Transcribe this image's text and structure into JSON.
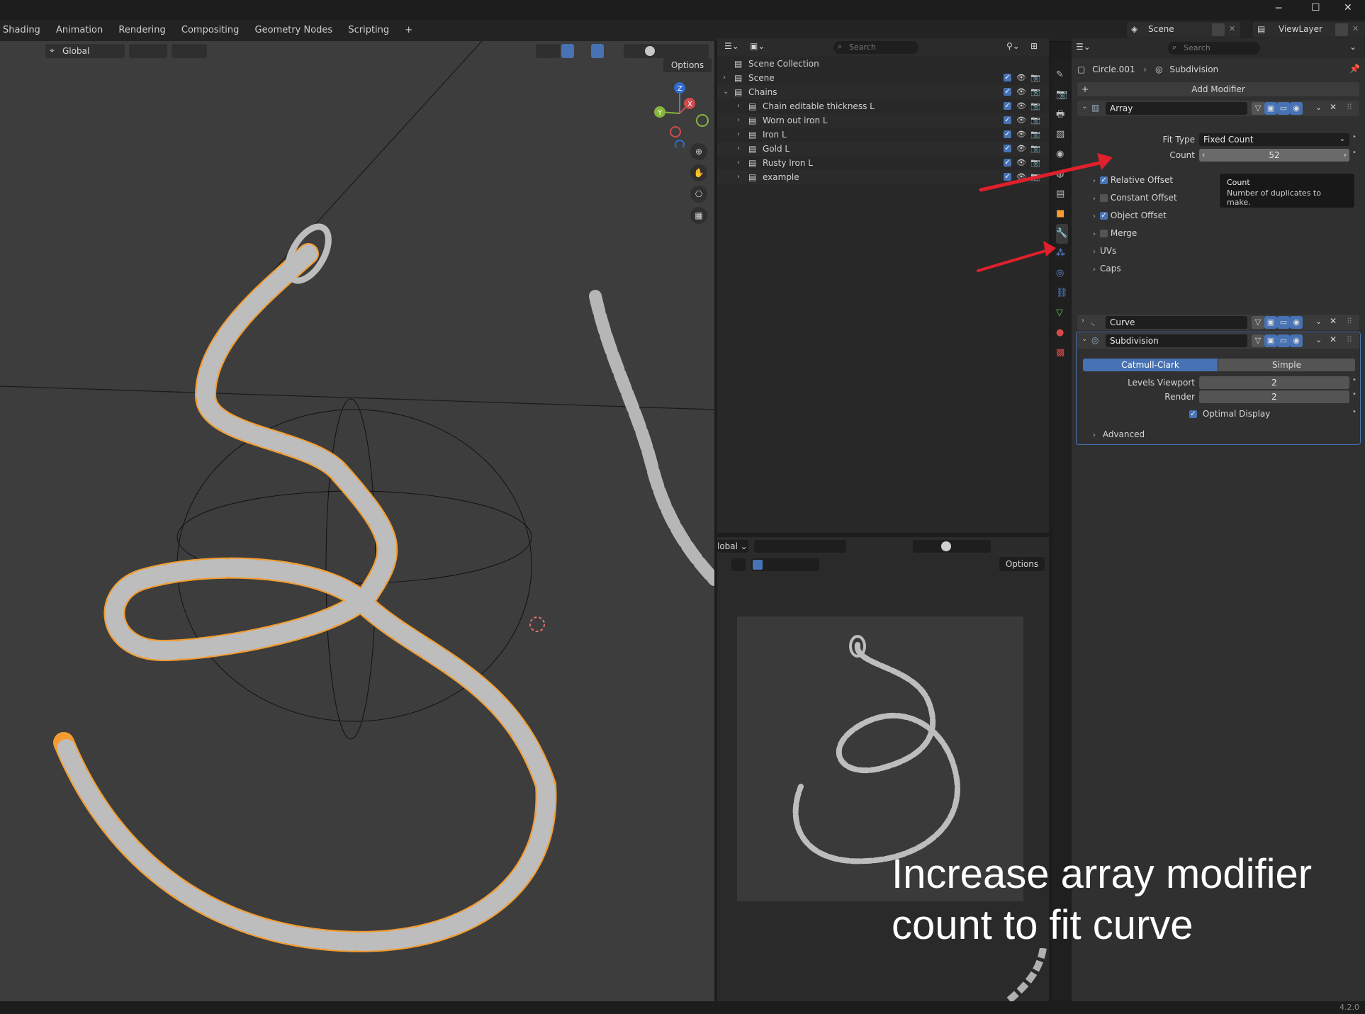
{
  "window": {
    "minimize": "─",
    "maximize": "☐",
    "close": "✕"
  },
  "workspaces": [
    "Shading",
    "Animation",
    "Rendering",
    "Compositing",
    "Geometry Nodes",
    "Scripting",
    "+"
  ],
  "scene_selector": {
    "value": "Scene"
  },
  "viewlayer_selector": {
    "value": "ViewLayer"
  },
  "viewport": {
    "orientation": "Global",
    "options_label": "Options",
    "gizmo_axes": [
      "Z",
      "X",
      "Y"
    ]
  },
  "outliner": {
    "search_placeholder": "Search",
    "scene_collection": "Scene Collection",
    "items": [
      {
        "label": "Scene",
        "indent": 1
      },
      {
        "label": "Chains",
        "indent": 1
      },
      {
        "label": "Chain editable thickness L",
        "indent": 2
      },
      {
        "label": "Worn out iron L",
        "indent": 2
      },
      {
        "label": "Iron L",
        "indent": 2
      },
      {
        "label": "Gold L",
        "indent": 2
      },
      {
        "label": "Rusty Iron L",
        "indent": 2
      },
      {
        "label": "example",
        "indent": 2
      }
    ]
  },
  "render_view": {
    "orientation": "lobal",
    "options_label": "Options"
  },
  "properties": {
    "search_placeholder": "Search",
    "breadcrumb_object": "Circle.001",
    "breadcrumb_modifier": "Subdivision",
    "add_modifier": "Add Modifier",
    "array": {
      "name": "Array",
      "fit_type_label": "Fit Type",
      "fit_type_value": "Fixed Count",
      "count_label": "Count",
      "count_value": "52",
      "sub": [
        {
          "label": "Relative Offset",
          "checked": true,
          "checkbox": true
        },
        {
          "label": "Constant Offset",
          "checked": false,
          "checkbox": true
        },
        {
          "label": "Object Offset",
          "checked": true,
          "checkbox": true
        },
        {
          "label": "Merge",
          "checked": false,
          "checkbox": true
        },
        {
          "label": "UVs",
          "checkbox": false
        },
        {
          "label": "Caps",
          "checkbox": false
        }
      ]
    },
    "curve": {
      "name": "Curve"
    },
    "subdivision": {
      "name": "Subdivision",
      "mode_a": "Catmull-Clark",
      "mode_b": "Simple",
      "levels_viewport_label": "Levels Viewport",
      "levels_viewport_value": "2",
      "render_label": "Render",
      "render_value": "2",
      "optimal_display_label": "Optimal Display",
      "advanced_label": "Advanced"
    },
    "tooltip": {
      "title": "Count",
      "body": "Number of duplicates to make."
    }
  },
  "annotation": {
    "line1": "Increase array modifier",
    "line2": "count to fit curve"
  },
  "version": "4.2.0",
  "colors": {
    "accent": "#4772b3",
    "selection_outline": "#f39c2f",
    "arrow": "#e0202c"
  }
}
